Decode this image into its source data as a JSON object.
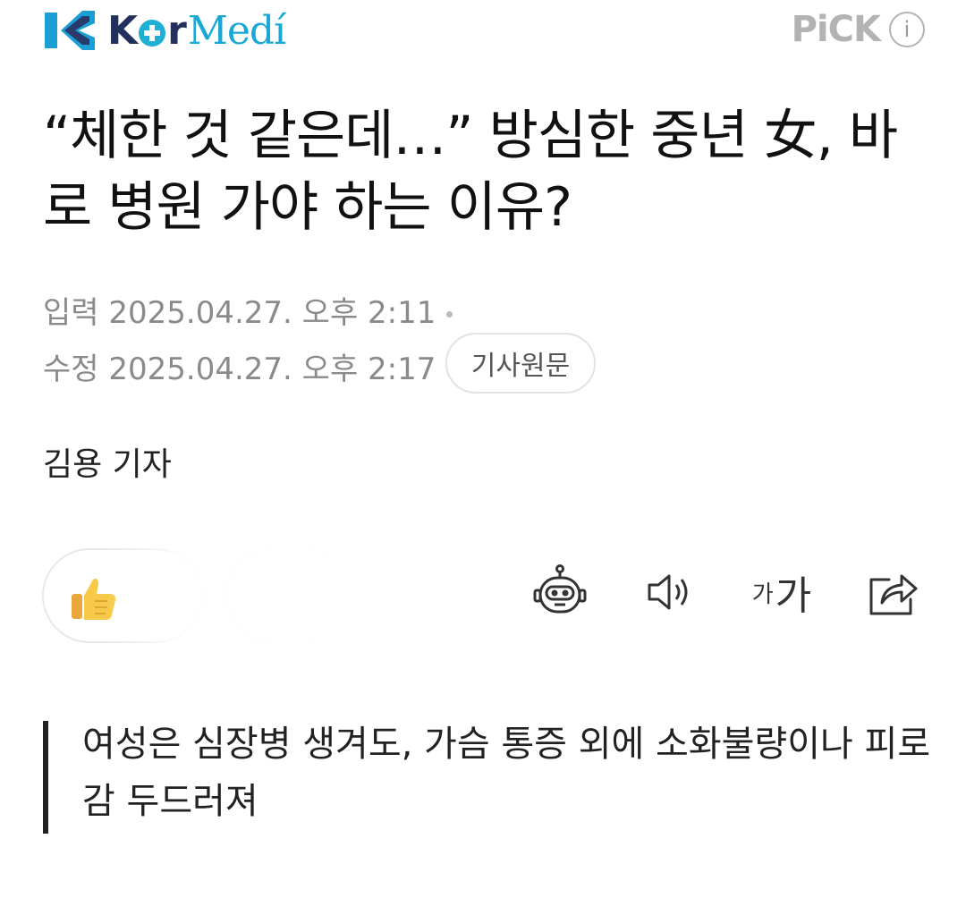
{
  "header": {
    "brand_k": "K",
    "brand_r": "r",
    "brand_medi": "Medí",
    "pick_label": "PiCK",
    "info_glyph": "i"
  },
  "article": {
    "title": "“체한 것 같은데…” 방심한 중년 女, 바로 병원 가야 하는 이유?",
    "input_label": "입력",
    "input_time": "2025.04.27. 오후 2:11",
    "modified_label": "수정",
    "modified_time": "2025.04.27. 오후 2:17",
    "source_button": "기사원문",
    "reporter": "김용 기자",
    "quote": "여성은 심장병 생겨도, 가슴 통증 외에 소화불량이나 피로감 두드러져"
  },
  "toolbar": {
    "font_small": "가",
    "font_big": "가"
  },
  "icons": {
    "reaction": "thumbs-up-icon",
    "summary": "robot-icon",
    "tts": "speaker-icon",
    "font": "font-size-icon",
    "share": "share-icon"
  },
  "colors": {
    "brand_navy": "#22305e",
    "brand_cyan": "#1aa7d6",
    "meta_gray": "#8a8a8a",
    "thumb_yellow": "#f7c948"
  }
}
